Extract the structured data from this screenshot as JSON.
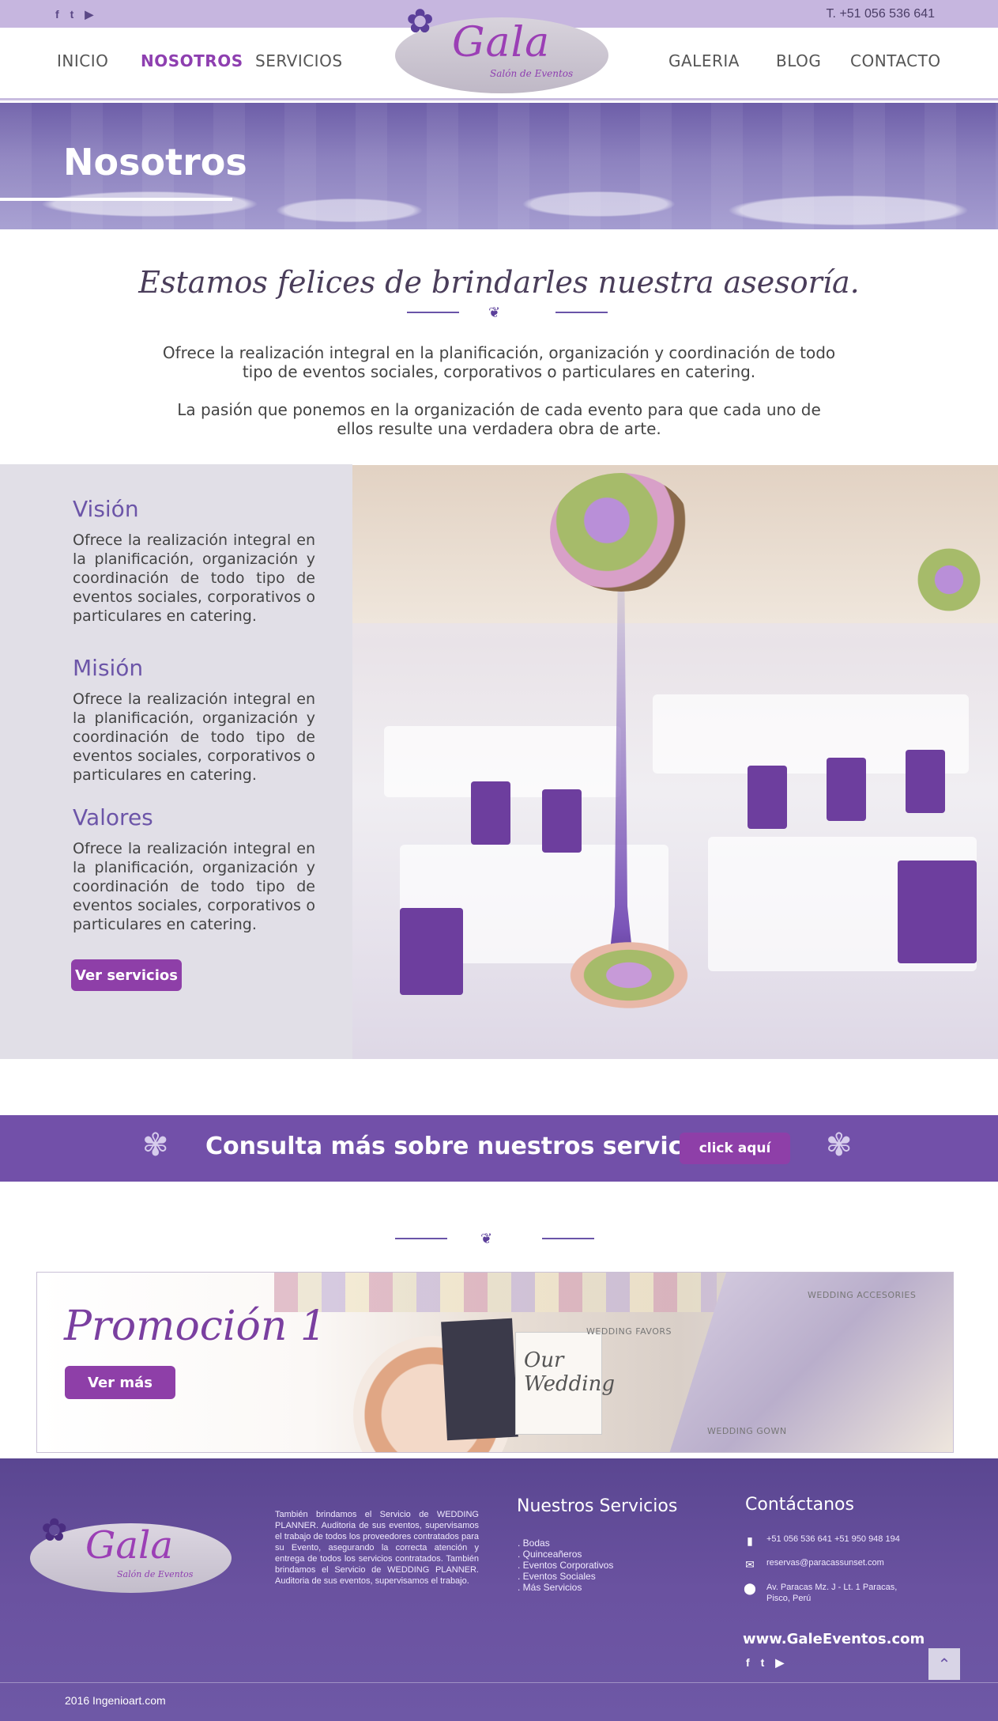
{
  "topbar": {
    "social": [
      "f",
      "t",
      "▶"
    ],
    "phone": "T. +51 056 536 641"
  },
  "nav": {
    "items": [
      "INICIO",
      "NOSOTROS",
      "SERVICIOS",
      "GALERIA",
      "BLOG",
      "CONTACTO"
    ],
    "active": "NOSOTROS"
  },
  "logo": {
    "name": "Gala",
    "subtitle": "Salón de Eventos"
  },
  "hero": {
    "title": "Nosotros"
  },
  "intro": {
    "title": "Estamos felices de brindarles nuestra asesoría.",
    "p1": "Ofrece la realización integral en la planificación, organización y coordinación de todo tipo de eventos sociales, corporativos o particulares en catering.",
    "p2": "La pasión que ponemos en la organización de cada evento para que cada uno de ellos resulte una verdadera obra de arte."
  },
  "values": {
    "vision_title": "Visión",
    "vision_text": "Ofrece la realización integral en la planificación, organización y coordinación de todo tipo de eventos sociales, corporativos o particulares en catering.",
    "mision_title": "Misión",
    "mision_text": "Ofrece la realización integral en la planificación, organización y coordinación de todo tipo de eventos sociales, corporativos o particulares en catering.",
    "valores_title": "Valores",
    "valores_text": "Ofrece la realización integral en la planificación, organización y coordinación de todo tipo de eventos sociales, corporativos o particulares en catering.",
    "button": "Ver servicios"
  },
  "cta": {
    "text": "Consulta más sobre nuestros servicios",
    "button": "click aquí"
  },
  "promo": {
    "title": "Promoción 1",
    "button": "Ver más",
    "labels": [
      "WEDDING FAVORS",
      "WEDDING ACCESORIES",
      "WEDDING GOWN"
    ],
    "card_text": "Our Wedding"
  },
  "footer": {
    "about": "También brindamos el Servicio de WEDDING PLANNER. Auditoria de sus eventos, supervisamos el trabajo de todos los proveedores contratados para su Evento, asegurando la correcta atención y entrega de todos los servicios contratados. También brindamos el Servicio de WEDDING PLANNER. Auditoria de sus eventos, supervisamos el trabajo.",
    "services_title": "Nuestros Servicios",
    "services": [
      ". Bodas",
      ". Quinceañeros",
      ". Eventos Corporativos",
      ". Eventos Sociales",
      ". Más Servicios"
    ],
    "contact_title": "Contáctanos",
    "phones": "+51 056 536 641 +51 950 948 194",
    "email": "reservas@paracassunset.com",
    "address": "Av. Paracas Mz. J - Lt. 1 Paracas, Pisco, Perú",
    "website": "www.GaleEventos.com",
    "social": [
      "f",
      "t",
      "▶"
    ],
    "copyright": "2016 Ingenioart.com"
  }
}
